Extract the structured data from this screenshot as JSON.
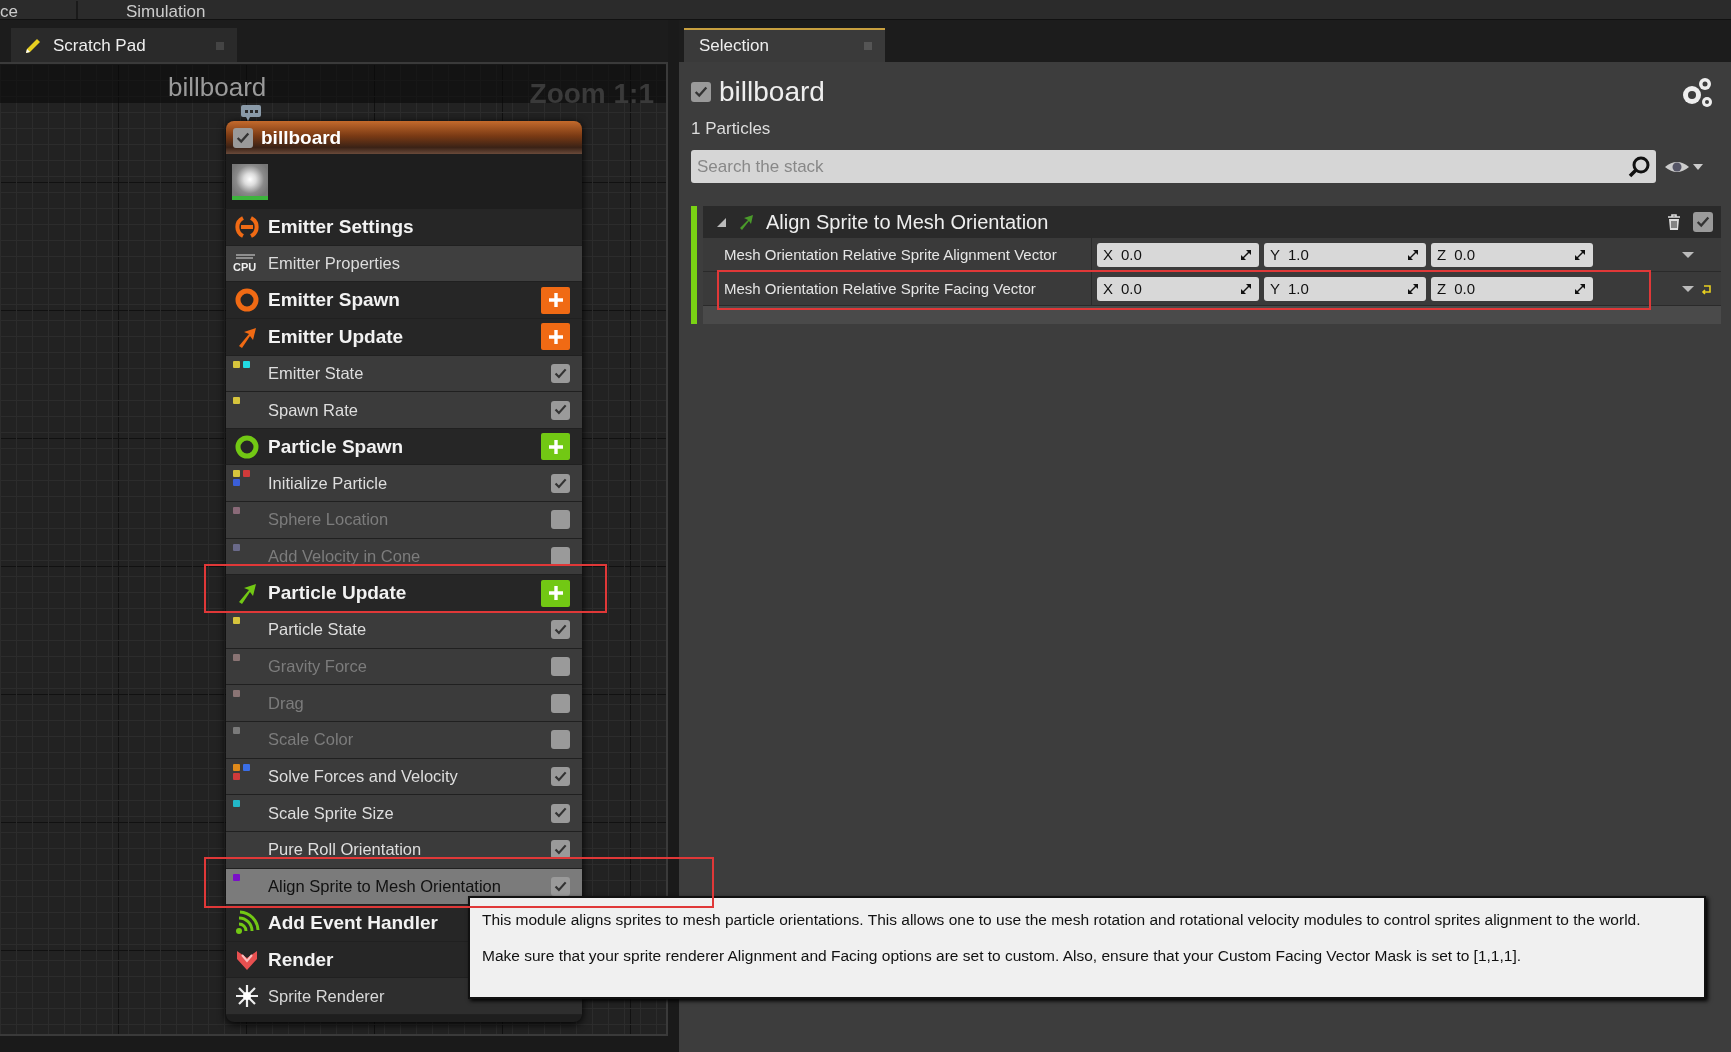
{
  "menu_bar": {
    "items": [
      "ce",
      "Simulation"
    ]
  },
  "graph_panel": {
    "tab": {
      "label": "Scratch Pad",
      "selected": false
    },
    "title": "billboard",
    "zoom": "Zoom 1:1",
    "node": {
      "title": "billboard",
      "enabled": true,
      "rows": [
        {
          "kind": "settings",
          "label": "Emitter Settings",
          "color": "#f06a14",
          "add_button": false,
          "highlighted": false
        },
        {
          "kind": "properties",
          "label": "Emitter Properties",
          "cpu_label": "CPU"
        },
        {
          "kind": "spawn",
          "label": "Emitter Spawn",
          "color": "#f06a14",
          "add_button": true,
          "highlighted": false
        },
        {
          "kind": "update",
          "label": "Emitter Update",
          "color": "#f06a14",
          "add_button": true,
          "highlighted": false
        },
        {
          "kind": "module",
          "label": "Emitter State",
          "enabled": true,
          "selected": false,
          "highlighted": false,
          "dots": [
            {
              "color": "#d6c43c"
            },
            {
              "color": "#22dce4"
            }
          ]
        },
        {
          "kind": "module",
          "label": "Spawn Rate",
          "enabled": true,
          "selected": false,
          "highlighted": false,
          "dots": [
            {
              "color": "#d6c43c"
            }
          ]
        },
        {
          "kind": "spawn",
          "label": "Particle Spawn",
          "color": "#72c814",
          "add_button": true,
          "highlighted": false
        },
        {
          "kind": "module",
          "label": "Initialize Particle",
          "enabled": true,
          "selected": false,
          "highlighted": false,
          "dots": [
            {
              "color": "#d6c43c"
            },
            {
              "color": "#d03a3a"
            },
            {
              "color": "#3a5ed8"
            }
          ]
        },
        {
          "kind": "module",
          "label": "Sphere Location",
          "enabled": false,
          "selected": false,
          "highlighted": false,
          "dots": [
            {
              "color": "#8a6a78"
            }
          ]
        },
        {
          "kind": "module",
          "label": "Add Velocity in Cone",
          "enabled": false,
          "selected": false,
          "highlighted": false,
          "dots": [
            {
              "color": "#6a6a8a"
            }
          ]
        },
        {
          "kind": "update",
          "label": "Particle Update",
          "color": "#72c814",
          "add_button": true,
          "highlighted": true
        },
        {
          "kind": "module",
          "label": "Particle State",
          "enabled": true,
          "selected": false,
          "highlighted": false,
          "dots": [
            {
              "color": "#d6c43c"
            }
          ]
        },
        {
          "kind": "module",
          "label": "Gravity Force",
          "enabled": false,
          "selected": false,
          "highlighted": false,
          "dots": [
            {
              "color": "#8a7474"
            }
          ]
        },
        {
          "kind": "module",
          "label": "Drag",
          "enabled": false,
          "selected": false,
          "highlighted": false,
          "dots": [
            {
              "color": "#8a7474"
            }
          ]
        },
        {
          "kind": "module",
          "label": "Scale Color",
          "enabled": false,
          "selected": false,
          "highlighted": false,
          "dots": [
            {
              "color": "#7a7a7a"
            }
          ]
        },
        {
          "kind": "module",
          "label": "Solve Forces and Velocity",
          "enabled": true,
          "selected": false,
          "highlighted": false,
          "dots": [
            {
              "color": "#e08a1a"
            },
            {
              "color": "#3a6ee8"
            },
            {
              "color": "#d03a3a"
            }
          ]
        },
        {
          "kind": "module",
          "label": "Scale Sprite Size",
          "enabled": true,
          "selected": false,
          "highlighted": false,
          "dots": [
            {
              "color": "#22b8c8"
            }
          ]
        },
        {
          "kind": "module",
          "label": "Pure Roll Orientation",
          "enabled": true,
          "selected": false,
          "highlighted": false
        },
        {
          "kind": "module",
          "label": "Align Sprite to Mesh Orientation",
          "enabled": true,
          "selected": true,
          "highlighted": true,
          "dots": [
            {
              "color": "#7a10c8"
            }
          ]
        },
        {
          "kind": "events",
          "label": "Add Event Handler",
          "color": "#72c814",
          "add_button": false,
          "highlighted": false
        },
        {
          "kind": "render",
          "label": "Render",
          "color": "#e85050",
          "add_button": false,
          "highlighted": false
        },
        {
          "kind": "renderer",
          "label": "Sprite Renderer"
        }
      ]
    }
  },
  "selection_panel": {
    "tab": {
      "label": "Selection",
      "selected": true
    },
    "emitter": {
      "name": "billboard",
      "enabled": true
    },
    "particle_count": "1 Particles",
    "search": {
      "placeholder": "Search the stack"
    },
    "module": {
      "title": "Align Sprite to Mesh Orientation",
      "expanded": true,
      "enabled": true,
      "inputs": [
        {
          "label": "Mesh Orientation Relative Sprite Alignment Vector",
          "modified": false,
          "highlighted": false,
          "fields": [
            {
              "axis": "X",
              "value": "0.0"
            },
            {
              "axis": "Y",
              "value": "1.0"
            },
            {
              "axis": "Z",
              "value": "0.0"
            }
          ]
        },
        {
          "label": "Mesh Orientation Relative Sprite Facing Vector",
          "modified": true,
          "highlighted": true,
          "fields": [
            {
              "axis": "X",
              "value": "0.0"
            },
            {
              "axis": "Y",
              "value": "1.0"
            },
            {
              "axis": "Z",
              "value": "0.0"
            }
          ]
        }
      ]
    }
  },
  "tooltip": {
    "paragraphs": [
      "This module aligns sprites to mesh particle orientations. This allows one to use the mesh rotation and rotational velocity modules to control sprites alignment to the world.",
      "Make sure that your sprite renderer Alignment and Facing options are set to custom. Also, ensure that your Custom Facing Vector Mask is set to [1,1,1]."
    ]
  }
}
